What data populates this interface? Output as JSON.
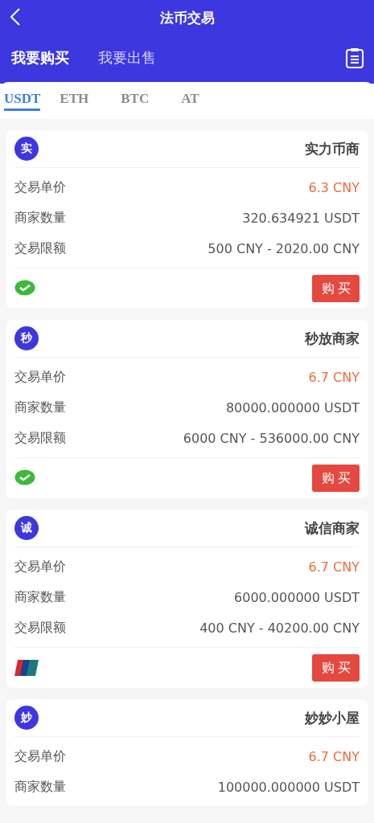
{
  "header": {
    "title": "法币交易"
  },
  "modes": [
    {
      "label": "我要购买",
      "selected": true
    },
    {
      "label": "我要出售",
      "selected": false
    }
  ],
  "coins": [
    {
      "label": "USDT",
      "selected": true
    },
    {
      "label": "ETH",
      "selected": false
    },
    {
      "label": "BTC",
      "selected": false
    },
    {
      "label": "AT",
      "selected": false
    }
  ],
  "merchants": [
    {
      "avatar": "实",
      "name": "实力币商",
      "rows": [
        {
          "kind": "price",
          "label": "交易单价",
          "value": "6.3 CNY"
        },
        {
          "kind": "plain",
          "label": "商家数量",
          "value": "320.634921 USDT"
        },
        {
          "kind": "plain",
          "label": "交易限额",
          "value": "500 CNY - 2020.00 CNY"
        }
      ],
      "payment": {
        "kind": "wechat"
      },
      "button": "购买"
    },
    {
      "avatar": "秒",
      "name": "秒放商家",
      "rows": [
        {
          "kind": "price",
          "label": "交易单价",
          "value": "6.7 CNY"
        },
        {
          "kind": "plain",
          "label": "商家数量",
          "value": "80000.000000 USDT"
        },
        {
          "kind": "plain",
          "label": "交易限额",
          "value": "6000 CNY - 536000.00 CNY"
        }
      ],
      "payment": {
        "kind": "wechat"
      },
      "button": "购买"
    },
    {
      "avatar": "诚",
      "name": "诚信商家",
      "rows": [
        {
          "kind": "price",
          "label": "交易单价",
          "value": "6.7 CNY"
        },
        {
          "kind": "plain",
          "label": "商家数量",
          "value": "6000.000000 USDT"
        },
        {
          "kind": "plain",
          "label": "交易限额",
          "value": "400 CNY - 40200.00 CNY"
        }
      ],
      "payment": {
        "kind": "unionpay"
      },
      "button": "购买"
    },
    {
      "avatar": "妙",
      "name": "妙妙小屋",
      "rows": [
        {
          "kind": "price",
          "label": "交易单价",
          "value": "6.7 CNY"
        },
        {
          "kind": "plain",
          "label": "商家数量",
          "value": "100000.000000 USDT"
        }
      ]
    }
  ]
}
